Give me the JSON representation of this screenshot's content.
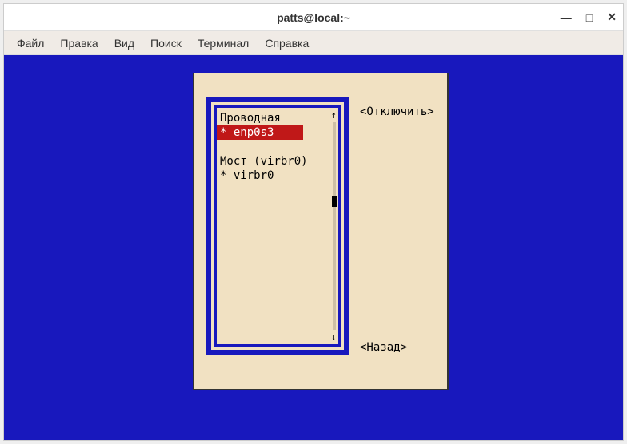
{
  "window": {
    "title": "patts@local:~"
  },
  "menubar": {
    "items": [
      "Файл",
      "Правка",
      "Вид",
      "Поиск",
      "Терминал",
      "Справка"
    ]
  },
  "dialog": {
    "list": {
      "header1": "Проводная",
      "selected": "* enp0s3",
      "blank": " ",
      "header2": "Мост (virbr0)",
      "item2": "* virbr0"
    },
    "buttons": {
      "disconnect": "<Отключить>",
      "back": "<Назад>"
    }
  },
  "controls": {
    "minimize": "—",
    "maximize": "□",
    "close": "✕"
  }
}
